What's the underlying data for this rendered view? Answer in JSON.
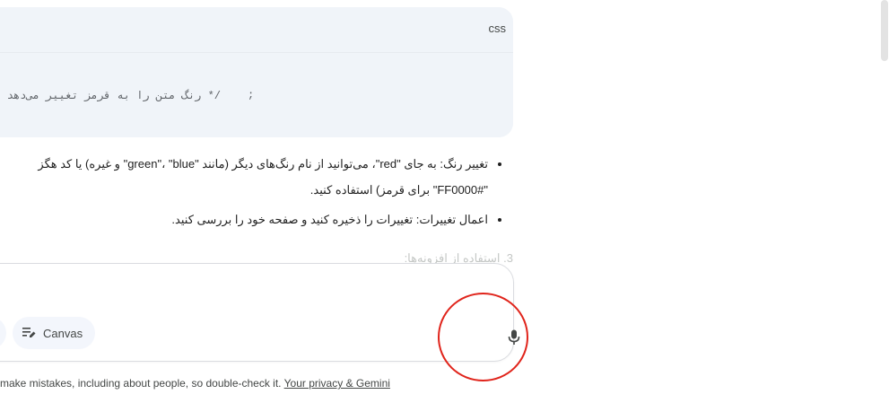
{
  "code_block": {
    "language": "css",
    "line": "/* رنگ متن را به قرمز تغییر می‌دهد */",
    "trailing": ";"
  },
  "bullets": [
    {
      "line1": "تغییر رنگ: به جای \"red\"، می‌توانید از نام رنگ‌های دیگر (مانند \"green\"، \"blue\" و غیره) یا کد هگز",
      "line2": "\"#FF0000\" برای قرمز) استفاده کنید."
    },
    {
      "line1": "اعمال تغییرات: تغییرات را ذخیره کنید و صفحه خود را بررسی کنید."
    }
  ],
  "faded_heading": "3. استفاده از افزونه‌ها:",
  "prompt": {
    "placeholder": "",
    "canvas_label": "Canvas"
  },
  "footer": {
    "text": "make mistakes, including about people, so double-check it.",
    "link": "Your privacy & Gemini"
  },
  "icons": {
    "mic": "mic-icon",
    "canvas": "canvas-icon"
  },
  "colors": {
    "annotation": "#e0241b",
    "card_bg": "#f0f4f9"
  }
}
